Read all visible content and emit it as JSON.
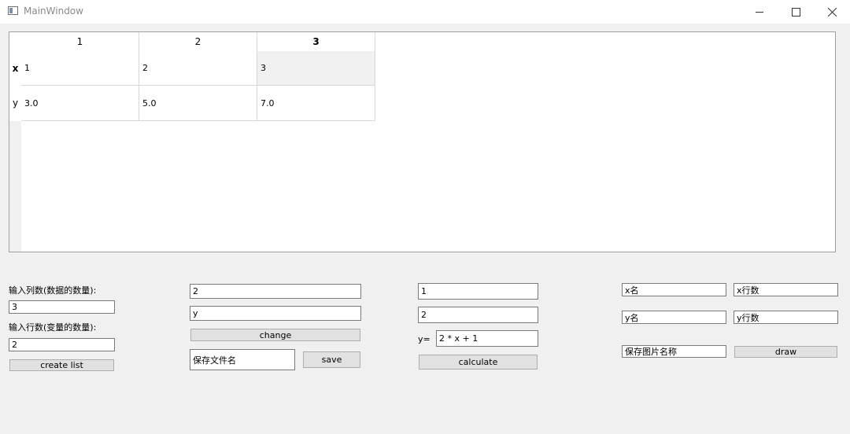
{
  "window": {
    "title": "MainWindow"
  },
  "table": {
    "col_headers": [
      "1",
      "2",
      "3"
    ],
    "row_headers": [
      "x",
      "y"
    ],
    "rows": [
      [
        "1",
        "2",
        "3"
      ],
      [
        "3.0",
        "5.0",
        "7.0"
      ]
    ]
  },
  "panel1": {
    "col_count_label": "输入列数(数据的数量):",
    "col_count_value": "3",
    "row_count_label": "输入行数(变量的数量):",
    "row_count_value": "2",
    "create_button": "create  list"
  },
  "panel2": {
    "input1": "2",
    "input2": "y",
    "change_button": "change",
    "filename_input": "保存文件名",
    "save_button": "save"
  },
  "panel3": {
    "input1": "1",
    "input2": "2",
    "y_label": "y=",
    "formula": "2 * x + 1",
    "calculate_button": "calculate"
  },
  "panel4": {
    "x_name": "x名",
    "x_row": "x行数",
    "y_name": "y名",
    "y_row": "y行数",
    "image_name": "保存图片名称",
    "draw_button": "draw"
  }
}
